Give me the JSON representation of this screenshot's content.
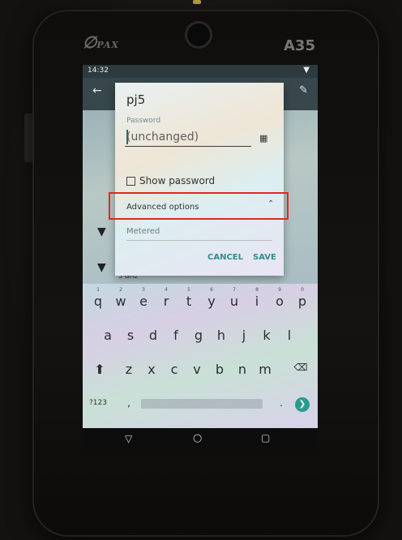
{
  "device": {
    "brand": "PAX",
    "model": "A35"
  },
  "status_bar": {
    "time": "14:32",
    "wifi_icon": "wifi-icon"
  },
  "app_bar": {
    "back_icon": "arrow-back-icon",
    "edit_icon": "pencil-icon"
  },
  "dialog": {
    "title": "pj5",
    "password_label": "Password",
    "password_placeholder": "(unchanged)",
    "qr_icon": "qr-scan-icon",
    "show_password_label": "Show password",
    "show_password_checked": false,
    "advanced_options_label": "Advanced options",
    "advanced_chevron_icon": "chevron-up-icon",
    "metered_label": "Metered",
    "cancel_label": "CANCEL",
    "save_label": "SAVE"
  },
  "background_list": {
    "freq_label": "5 GHz"
  },
  "keyboard": {
    "row1": [
      "q",
      "w",
      "e",
      "r",
      "t",
      "y",
      "u",
      "i",
      "o",
      "p"
    ],
    "row1_numbers": [
      "1",
      "2",
      "3",
      "4",
      "5",
      "6",
      "7",
      "8",
      "9",
      "0"
    ],
    "row2": [
      "a",
      "s",
      "d",
      "f",
      "g",
      "h",
      "j",
      "k",
      "l"
    ],
    "row3": [
      "z",
      "x",
      "c",
      "v",
      "b",
      "n",
      "m"
    ],
    "symbols_label": "?123",
    "comma": ",",
    "period": "."
  },
  "highlight": {
    "color": "#e0281f"
  }
}
